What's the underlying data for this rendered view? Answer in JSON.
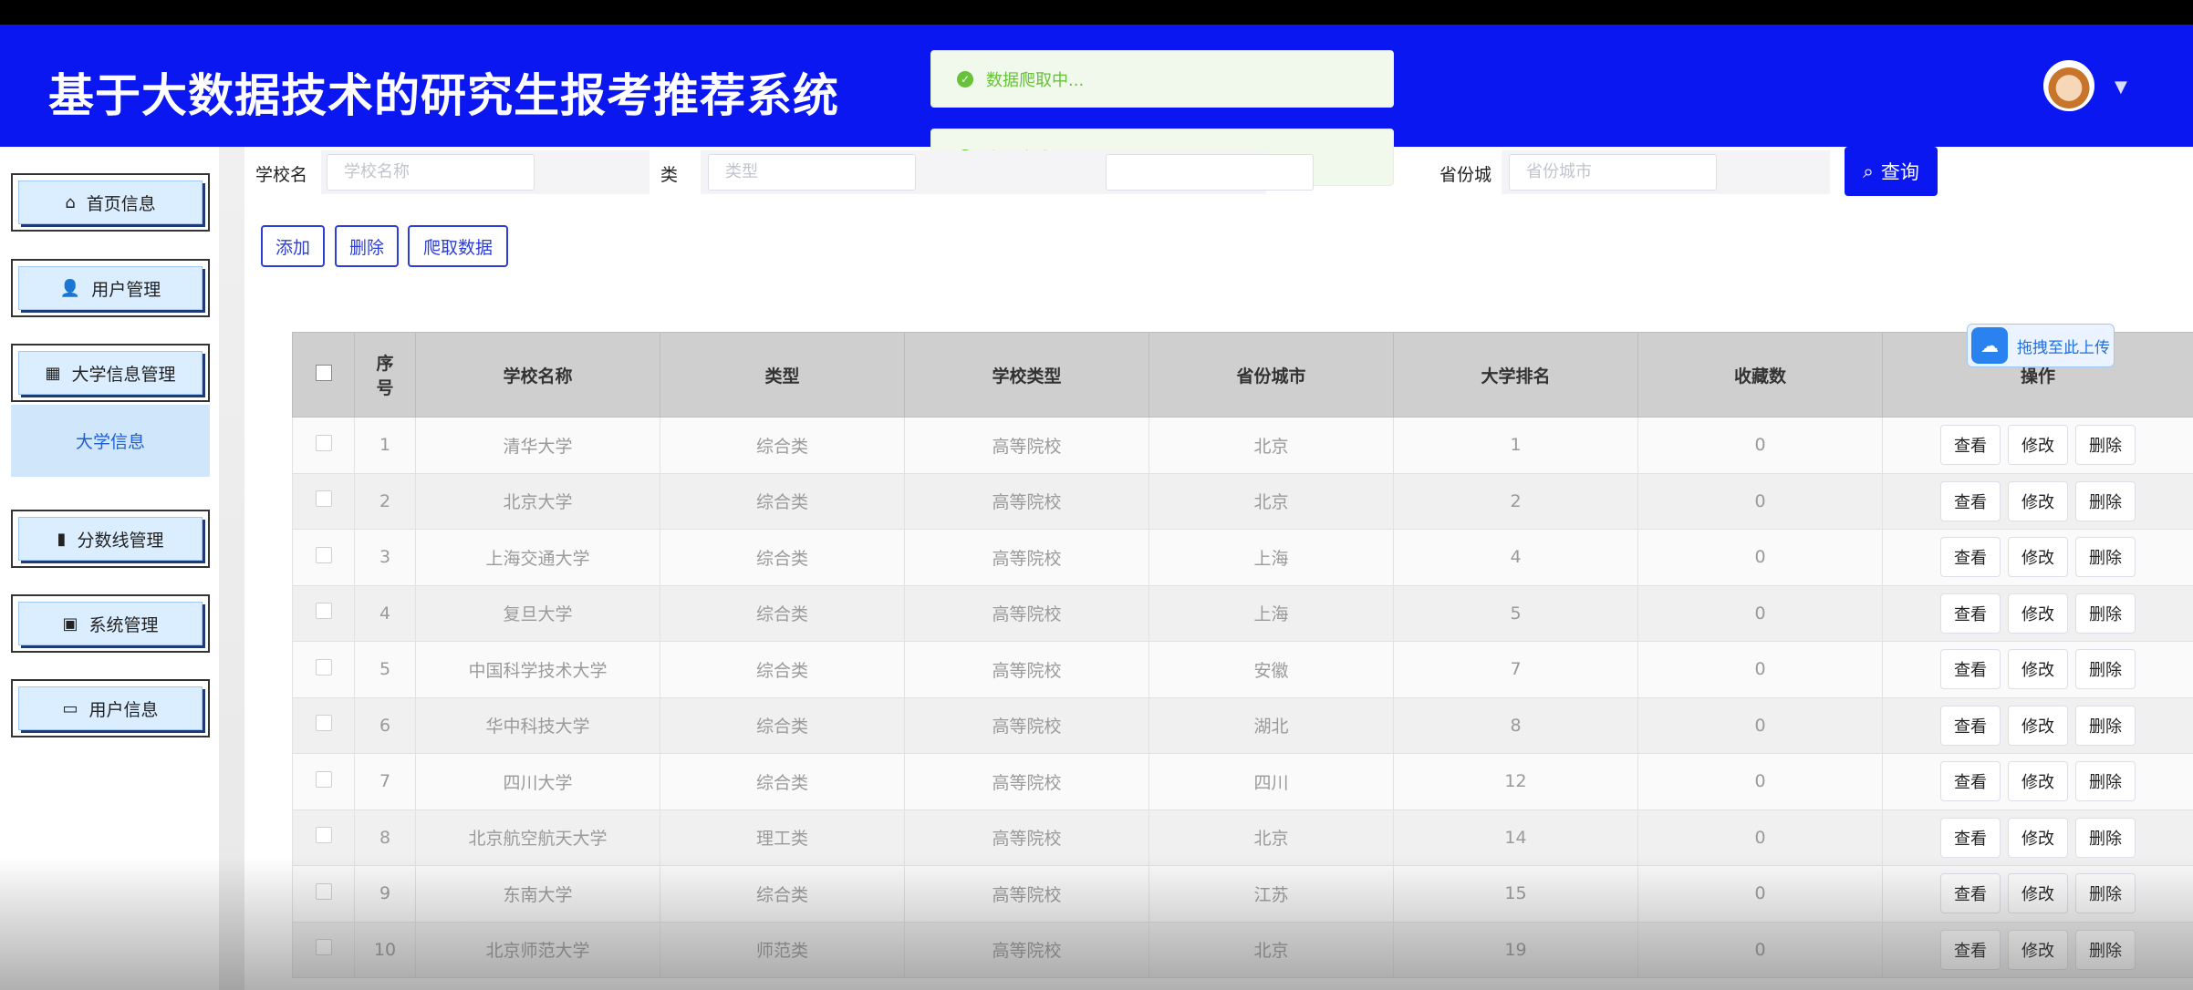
{
  "header": {
    "title": "基于大数据技术的研究生报考推荐系统"
  },
  "toasts": [
    {
      "text": "数据爬取中..."
    },
    {
      "text": "爬取完成"
    }
  ],
  "sidebar": {
    "items": [
      {
        "label": "首页信息",
        "icon": "home-icon"
      },
      {
        "label": "用户管理",
        "icon": "user-icon"
      },
      {
        "label": "大学信息管理",
        "icon": "grid-icon"
      },
      {
        "label": "分数线管理",
        "icon": "chart-icon"
      },
      {
        "label": "系统管理",
        "icon": "clipboard-icon"
      },
      {
        "label": "用户信息",
        "icon": "card-icon"
      }
    ],
    "submenu": {
      "label": "大学信息"
    }
  },
  "search": {
    "school_name": {
      "label": "学校名",
      "placeholder": "学校名称"
    },
    "type": {
      "label": "类",
      "placeholder": "类型"
    },
    "province": {
      "label": "省份城",
      "placeholder": "省份城市"
    },
    "button": "查询"
  },
  "actions": {
    "add": "添加",
    "delete": "删除",
    "crawl": "爬取数据"
  },
  "upload_tag": "拖拽至此上传",
  "table": {
    "headers": [
      "序\n号",
      "学校名称",
      "类型",
      "学校类型",
      "省份城市",
      "大学排名",
      "收藏数",
      "操作"
    ],
    "row_ops": {
      "view": "查看",
      "edit": "修改",
      "delete": "删除"
    },
    "rows": [
      [
        "1",
        "清华大学",
        "综合类",
        "高等院校",
        "北京",
        "1",
        "0"
      ],
      [
        "2",
        "北京大学",
        "综合类",
        "高等院校",
        "北京",
        "2",
        "0"
      ],
      [
        "3",
        "上海交通大学",
        "综合类",
        "高等院校",
        "上海",
        "4",
        "0"
      ],
      [
        "4",
        "复旦大学",
        "综合类",
        "高等院校",
        "上海",
        "5",
        "0"
      ],
      [
        "5",
        "中国科学技术大学",
        "综合类",
        "高等院校",
        "安徽",
        "7",
        "0"
      ],
      [
        "6",
        "华中科技大学",
        "综合类",
        "高等院校",
        "湖北",
        "8",
        "0"
      ],
      [
        "7",
        "四川大学",
        "综合类",
        "高等院校",
        "四川",
        "12",
        "0"
      ],
      [
        "8",
        "北京航空航天大学",
        "理工类",
        "高等院校",
        "北京",
        "14",
        "0"
      ],
      [
        "9",
        "东南大学",
        "综合类",
        "高等院校",
        "江苏",
        "15",
        "0"
      ],
      [
        "10",
        "北京师范大学",
        "师范类",
        "高等院校",
        "北京",
        "19",
        "0"
      ]
    ]
  }
}
